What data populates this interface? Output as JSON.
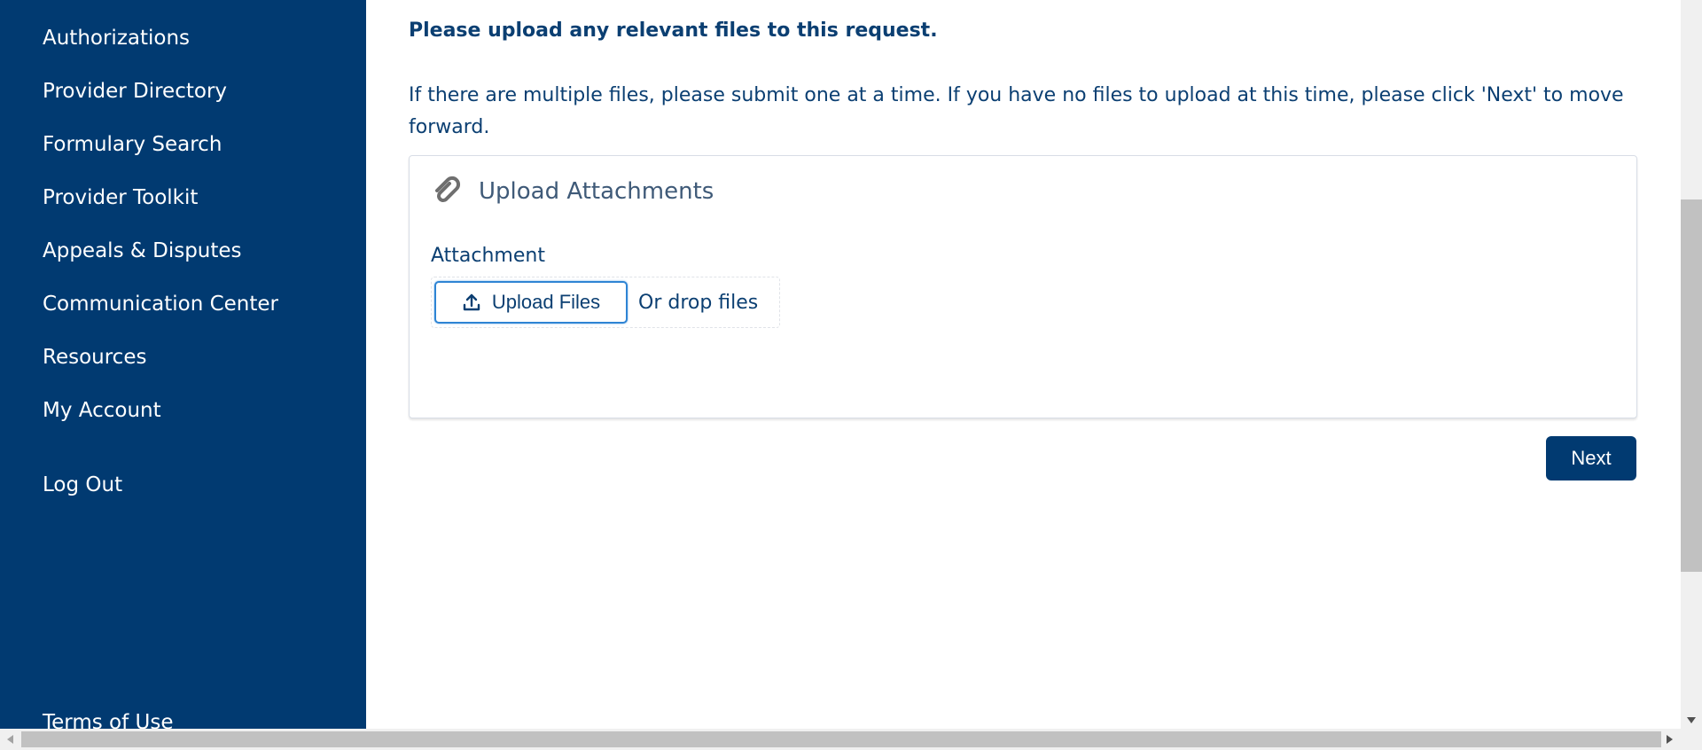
{
  "sidebar": {
    "items": [
      {
        "label": "Authorizations"
      },
      {
        "label": "Provider Directory"
      },
      {
        "label": "Formulary Search"
      },
      {
        "label": "Provider Toolkit"
      },
      {
        "label": "Appeals & Disputes"
      },
      {
        "label": "Communication Center"
      },
      {
        "label": "Resources"
      },
      {
        "label": "My Account"
      },
      {
        "label": "Log Out"
      },
      {
        "label": "Terms of Use"
      }
    ]
  },
  "main": {
    "heading": "Please upload any relevant files to this request.",
    "instructions": "If there are multiple files, please submit one at a time. If you have no files to upload at this time, please click 'Next' to move forward.",
    "card": {
      "icon": "paperclip-icon",
      "title": "Upload Attachments",
      "field_label": "Attachment",
      "upload_button_icon": "upload-icon",
      "upload_button_label": "Upload Files",
      "drop_label": "Or drop files"
    },
    "next_label": "Next"
  },
  "colors": {
    "sidebar_bg": "#013a71",
    "text_primary": "#0b3f72",
    "button_bg": "#013a71",
    "focus_border": "#2e84d4"
  }
}
